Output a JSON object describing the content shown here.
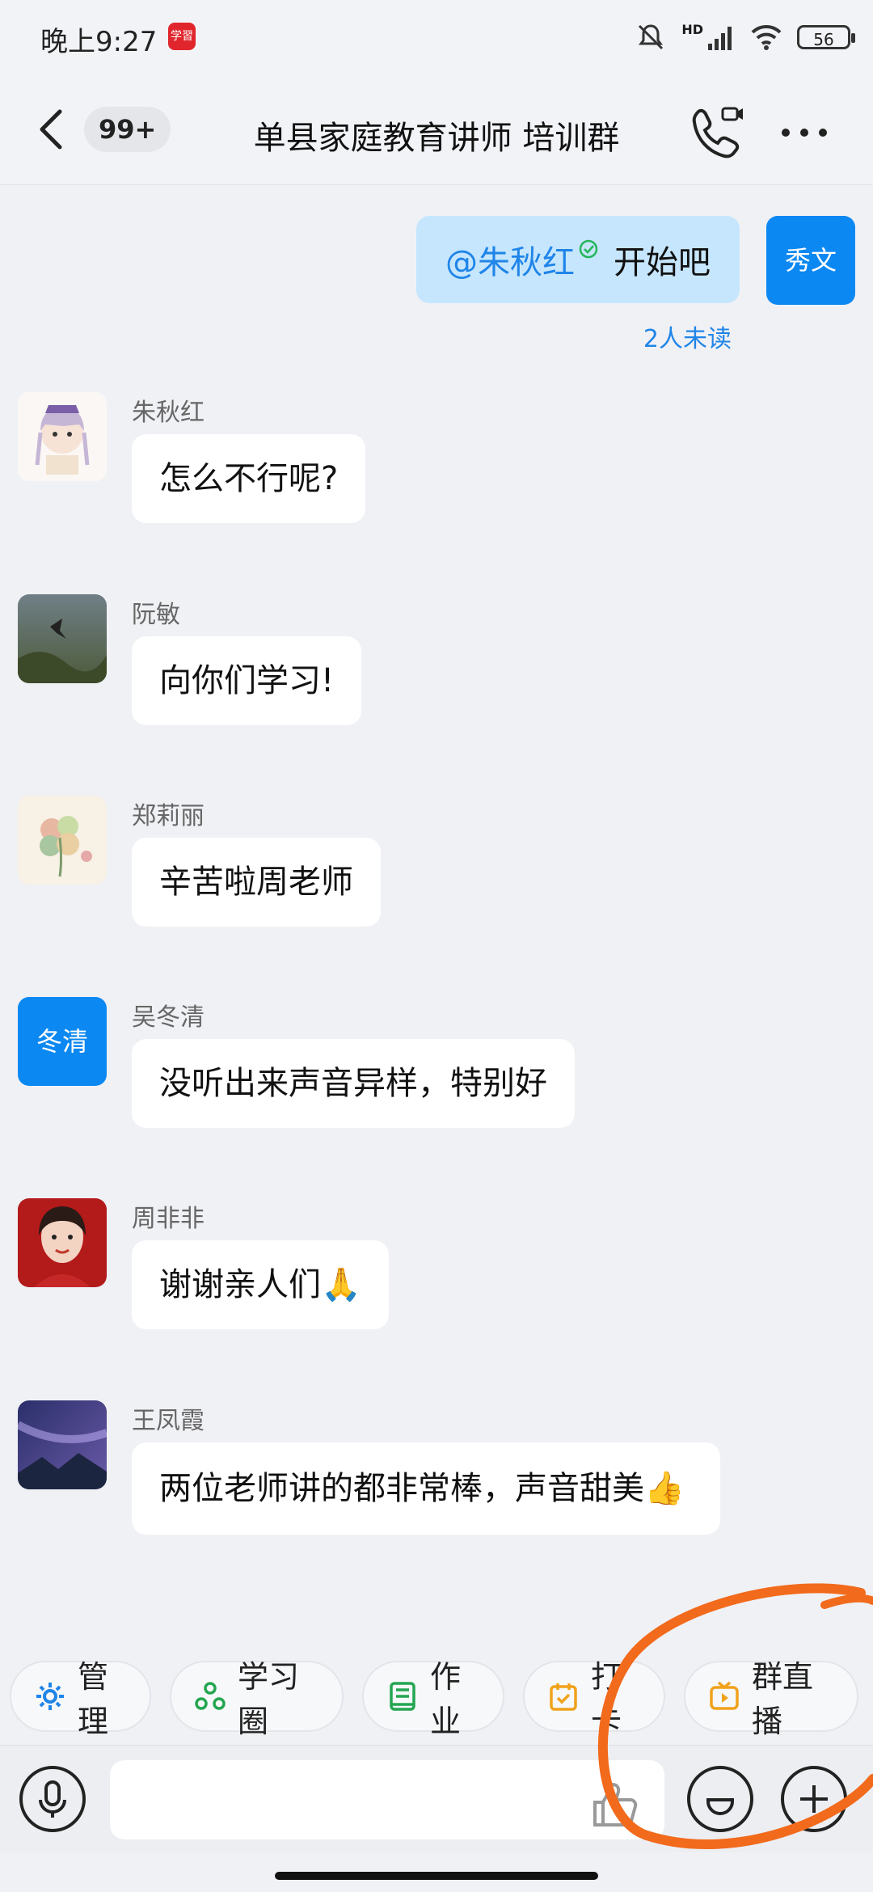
{
  "status_bar": {
    "time": "晚上9:27",
    "app_badge": "学習",
    "network": "HD",
    "battery": "56"
  },
  "header": {
    "unread_count": "99+",
    "title": "单县家庭教育讲师 培训群"
  },
  "my_message": {
    "mention": "@朱秋红",
    "text": "开始吧",
    "avatar_text": "秀文",
    "read_status": "2人未读"
  },
  "messages": [
    {
      "sender": "朱秋红",
      "text": "怎么不行呢?"
    },
    {
      "sender": "阮敏",
      "text": "向你们学习!"
    },
    {
      "sender": "郑莉丽",
      "text": "辛苦啦周老师"
    },
    {
      "sender": "吴冬清",
      "avatar_text": "冬清",
      "text": "没听出来声音异样，特别好"
    },
    {
      "sender": "周非非",
      "text": "谢谢亲人们🙏"
    },
    {
      "sender": "王凤霞",
      "text": "两位老师讲的都非常棒，声音甜美👍"
    }
  ],
  "quick_actions": [
    {
      "label": "管理",
      "icon": "gear-icon"
    },
    {
      "label": "学习圈",
      "icon": "circle-group-icon"
    },
    {
      "label": "作业",
      "icon": "book-icon"
    },
    {
      "label": "打卡",
      "icon": "calendar-check-icon"
    },
    {
      "label": "群直播",
      "icon": "tv-play-icon"
    }
  ],
  "colors": {
    "accent": "#1f85e8",
    "my_bubble": "#c6e6fd",
    "annotation": "#f26a1b"
  }
}
